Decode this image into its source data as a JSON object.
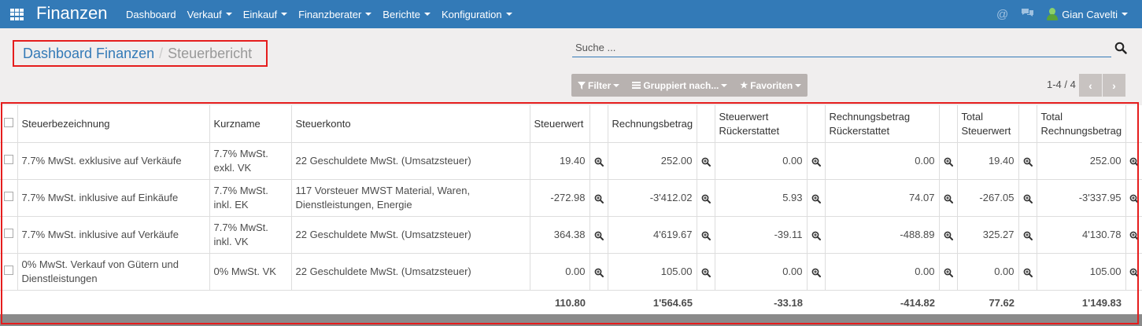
{
  "app": {
    "title": "Finanzen"
  },
  "menu": [
    {
      "label": "Dashboard",
      "dropdown": false
    },
    {
      "label": "Verkauf",
      "dropdown": true
    },
    {
      "label": "Einkauf",
      "dropdown": true
    },
    {
      "label": "Finanzberater",
      "dropdown": true
    },
    {
      "label": "Berichte",
      "dropdown": true
    },
    {
      "label": "Konfiguration",
      "dropdown": true
    }
  ],
  "systray": {
    "user_name": "Gian Cavelti"
  },
  "breadcrumb": {
    "parent": "Dashboard Finanzen",
    "separator": "/",
    "current": "Steuerbericht"
  },
  "search": {
    "placeholder": "Suche ..."
  },
  "search_buttons": {
    "filter": "Filter",
    "group": "Gruppiert nach...",
    "favorites": "Favoriten"
  },
  "pager": {
    "value": "1-4 / 4"
  },
  "table": {
    "headers": {
      "name": "Steuerbezeichnung",
      "short": "Kurzname",
      "account": "Steuerkonto",
      "tax": "Steuerwert",
      "invoice": "Rechnungsbetrag",
      "tax_refund": "Steuerwert Rückerstattet",
      "invoice_refund": "Rechnungsbetrag Rückerstattet",
      "total_tax": "Total Steuerwert",
      "total_invoice": "Total Rechnungsbetrag"
    },
    "rows": [
      {
        "name": "7.7% MwSt. exklusive auf Verkäufe",
        "short": "7.7% MwSt. exkl. VK",
        "account": "22 Geschuldete MwSt. (Umsatzsteuer)",
        "tax": "19.40",
        "invoice": "252.00",
        "tax_refund": "0.00",
        "invoice_refund": "0.00",
        "total_tax": "19.40",
        "total_invoice": "252.00"
      },
      {
        "name": "7.7% MwSt. inklusive auf Einkäufe",
        "short": "7.7% MwSt. inkl. EK",
        "account": "117 Vorsteuer MWST Material, Waren, Dienstleistungen, Energie",
        "tax": "-272.98",
        "invoice": "-3'412.02",
        "tax_refund": "5.93",
        "invoice_refund": "74.07",
        "total_tax": "-267.05",
        "total_invoice": "-3'337.95"
      },
      {
        "name": "7.7% MwSt. inklusive auf Verkäufe",
        "short": "7.7% MwSt. inkl. VK",
        "account": "22 Geschuldete MwSt. (Umsatzsteuer)",
        "tax": "364.38",
        "invoice": "4'619.67",
        "tax_refund": "-39.11",
        "invoice_refund": "-488.89",
        "total_tax": "325.27",
        "total_invoice": "4'130.78"
      },
      {
        "name": "0% MwSt. Verkauf von Gütern und Dienstleistungen",
        "short": "0% MwSt. VK",
        "account": "22 Geschuldete MwSt. (Umsatzsteuer)",
        "tax": "0.00",
        "invoice": "105.00",
        "tax_refund": "0.00",
        "invoice_refund": "0.00",
        "total_tax": "0.00",
        "total_invoice": "105.00"
      }
    ],
    "totals": {
      "tax": "110.80",
      "invoice": "1'564.65",
      "tax_refund": "-33.18",
      "invoice_refund": "-414.82",
      "total_tax": "77.62",
      "total_invoice": "1'149.83"
    }
  },
  "colors": {
    "navbar": "#337ab7",
    "background": "#f0eeee",
    "highlight": "#e51d1d",
    "link": "#337ab7"
  }
}
